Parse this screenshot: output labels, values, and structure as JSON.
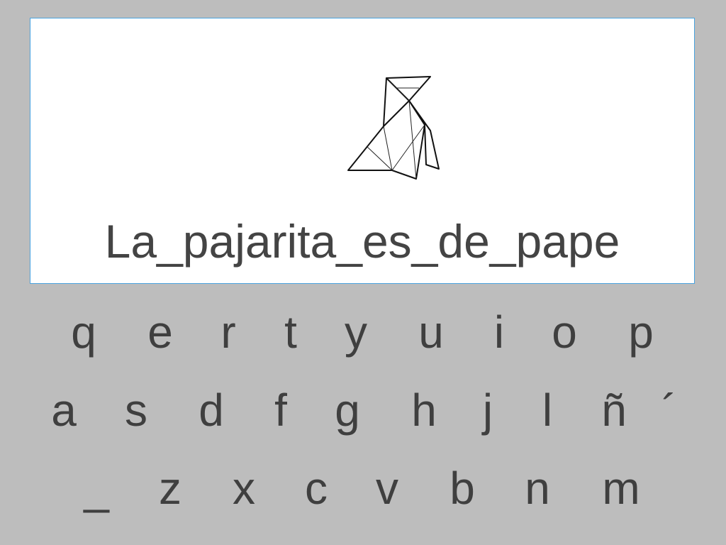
{
  "phrase": {
    "text": "La_pajarita_es_de_pape"
  },
  "picture": {
    "icon": "origami-paper-bird-icon"
  },
  "keyboard": {
    "row1": [
      "q",
      "e",
      "r",
      "t",
      "y",
      "u",
      "i",
      "o",
      "p"
    ],
    "row2": [
      "a",
      "s",
      "d",
      "f",
      "g",
      "h",
      "j",
      "l",
      "ñ",
      "´"
    ],
    "row3": [
      "_",
      "z",
      "x",
      "c",
      "v",
      "b",
      "n",
      "m"
    ]
  },
  "colors": {
    "background": "#bdbdbd",
    "card": "#ffffff",
    "card_border": "#4aa3df",
    "text": "#444444"
  }
}
